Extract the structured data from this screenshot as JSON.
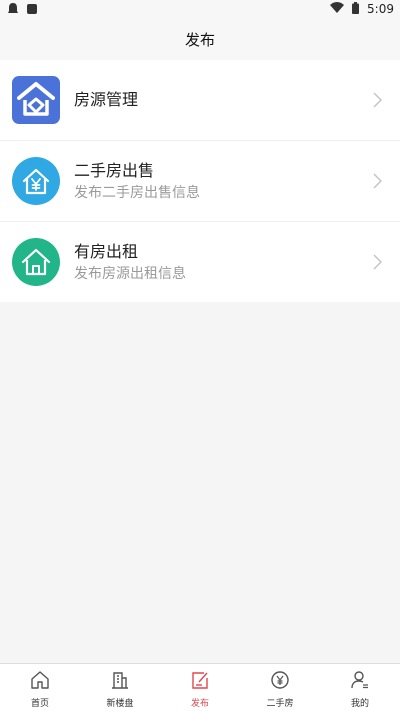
{
  "status_bar": {
    "time": "5:09"
  },
  "header": {
    "title": "发布"
  },
  "menu": [
    {
      "title": "房源管理",
      "subtitle": "",
      "icon": "house-manage-icon",
      "color": "#4a72d8"
    },
    {
      "title": "二手房出售",
      "subtitle": "发布二手房出售信息",
      "icon": "house-yen-icon",
      "color": "#2fa8e3"
    },
    {
      "title": "有房出租",
      "subtitle": "发布房源出租信息",
      "icon": "house-rent-icon",
      "color": "#22b58a"
    }
  ],
  "tabs": [
    {
      "label": "首页",
      "icon": "home-icon",
      "active": false
    },
    {
      "label": "新楼盘",
      "icon": "building-icon",
      "active": false
    },
    {
      "label": "发布",
      "icon": "publish-icon",
      "active": true
    },
    {
      "label": "二手房",
      "icon": "yen-circle-icon",
      "active": false
    },
    {
      "label": "我的",
      "icon": "user-icon",
      "active": false
    }
  ],
  "colors": {
    "accent": "#e0474c",
    "background": "#f5f5f5"
  }
}
